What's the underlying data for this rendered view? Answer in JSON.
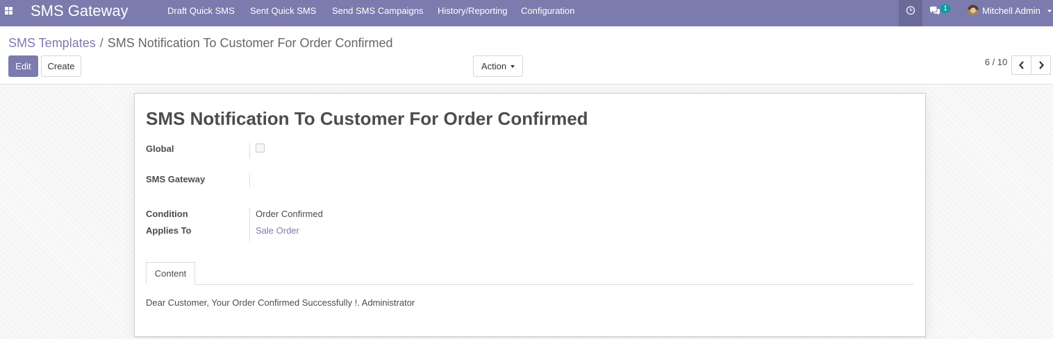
{
  "navbar": {
    "app_name": "SMS Gateway",
    "menu": [
      "Draft Quick SMS",
      "Sent Quick SMS",
      "Send SMS Campaigns",
      "History/Reporting",
      "Configuration"
    ],
    "message_count": "1",
    "user_name": "Mitchell Admin"
  },
  "breadcrumb": {
    "parent": "SMS Templates",
    "separator": "/",
    "current": "SMS Notification To Customer For Order Confirmed"
  },
  "toolbar": {
    "edit_label": "Edit",
    "create_label": "Create",
    "action_label": "Action"
  },
  "pager": {
    "value": "6 / 10"
  },
  "record": {
    "title": "SMS Notification To Customer For Order Confirmed",
    "fields": {
      "global_label": "Global",
      "global_checked": false,
      "gateway_label": "SMS Gateway",
      "gateway_value": "",
      "condition_label": "Condition",
      "condition_value": "Order Confirmed",
      "applies_to_label": "Applies To",
      "applies_to_value": "Sale Order"
    },
    "tab_label": "Content",
    "content": "Dear Customer, Your Order Confirmed Successfully !. Administrator"
  },
  "colors": {
    "brand": "#7c7bad",
    "badge": "#00a09d"
  }
}
